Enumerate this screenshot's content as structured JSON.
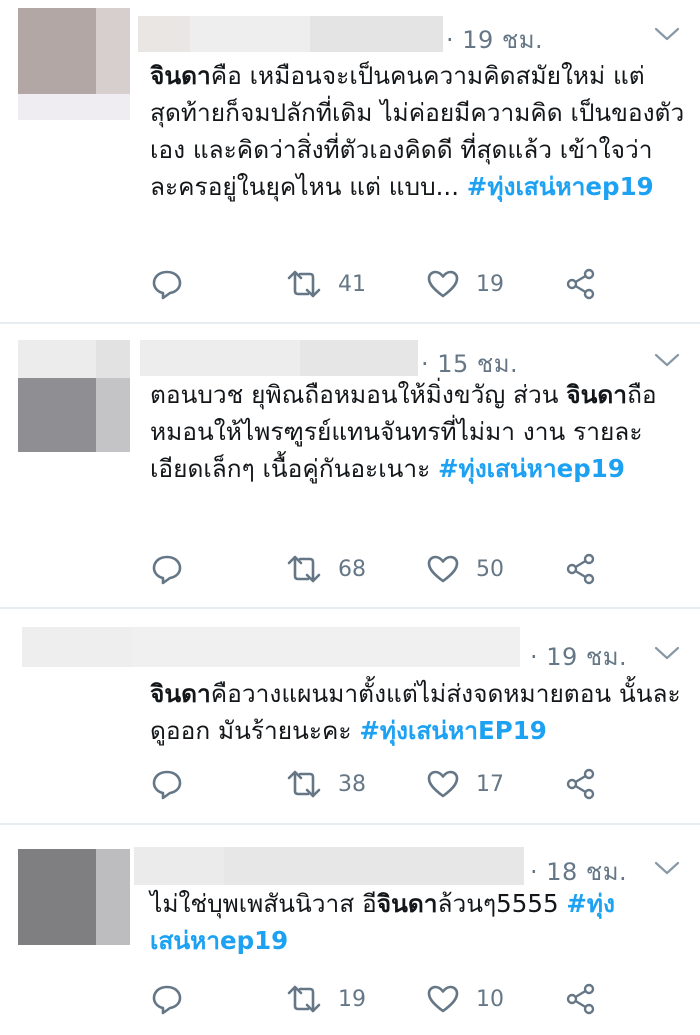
{
  "tweets": [
    {
      "time": "· 19 ชม.",
      "lead_bold": "จินดา",
      "text": "คือ เหมือนจะเป็นคนความคิดสมัยใหม่ แต่สุดท้ายก็จมปลักที่เดิม ไม่ค่อยมีความคิด เป็นของตัวเอง และคิดว่าสิ่งที่ตัวเองคิดดี ที่สุดแล้ว เข้าใจว่าละครอยู่ในยุคไหน แต่ แบบ... ",
      "hashtag": "#ทุ่งเสน่หาep19",
      "retweets": "41",
      "likes": "19"
    },
    {
      "time": "· 15 ชม.",
      "pre": "ตอนบวช ยุพิณถือหมอนให้มิ่งขวัญ ส่วน ",
      "mid_bold": "จินดา",
      "text": "ถือหมอนให้ไพรฑูรย์แทนจันทรที่ไม่มา งาน รายละเอียดเล็กๆ เนื้อคู่กันอะเนาะ ",
      "hashtag": "#ทุ่งเสน่หาep19",
      "retweets": "68",
      "likes": "50"
    },
    {
      "time": "· 19 ชม.",
      "lead_bold": "จินดา",
      "text": "คือวางแผนมาตั้งแต่ไม่ส่งจดหมายตอน นั้นละ ดูออก มันร้ายนะคะ ",
      "hashtag": "#ทุ่งเสน่หาEP19",
      "retweets": "38",
      "likes": "17"
    },
    {
      "time": "· 18 ชม.",
      "pre": "ไม่ใช่บุพเพสันนิวาส อี",
      "mid_bold": "จินดา",
      "text": "ล้วนๆ5555 ",
      "hashtag": "#ทุ่งเสน่หาep19",
      "retweets": "19",
      "likes": "10"
    }
  ],
  "colors": {
    "accent": "#1da1f2",
    "muted": "#657786",
    "divider": "#e6ecf0"
  },
  "icons": [
    "reply-icon",
    "retweet-icon",
    "like-icon",
    "share-icon",
    "chevron-down-icon"
  ]
}
